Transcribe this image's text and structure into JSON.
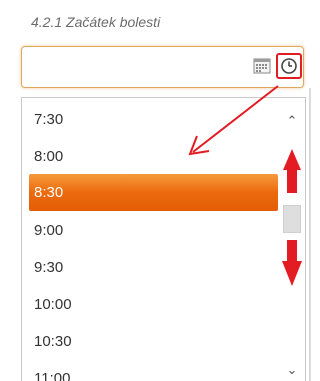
{
  "field": {
    "label": "4.2.1 Začátek bolesti",
    "value": ""
  },
  "icons": {
    "calendar": "calendar-icon",
    "clock": "clock-icon"
  },
  "dropdown": {
    "options": [
      "7:30",
      "8:00",
      "8:30",
      "9:00",
      "9:30",
      "10:00",
      "10:30",
      "11:00"
    ],
    "selected": "8:30"
  },
  "colors": {
    "selected_bg": "#ec6a0d",
    "annotation": "#e31b23",
    "input_border": "#e0a85a"
  }
}
